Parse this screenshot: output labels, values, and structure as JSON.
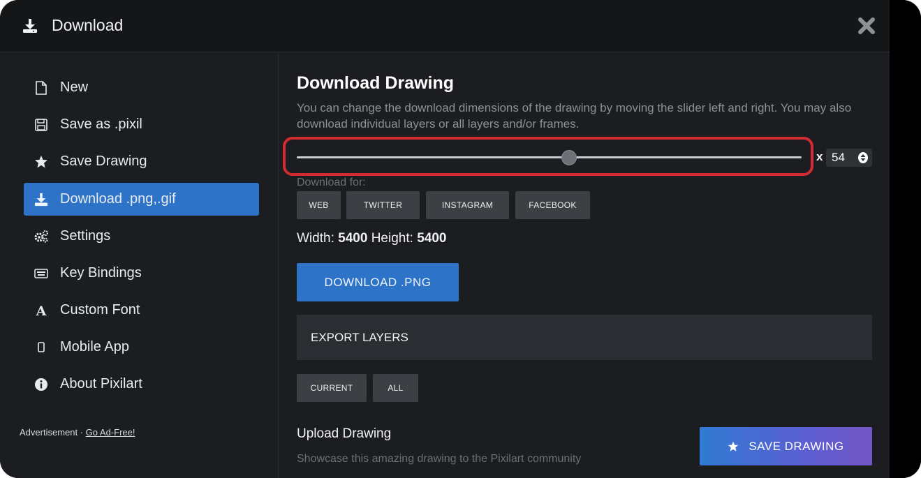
{
  "header": {
    "title": "Download",
    "icon": "download-icon",
    "close_icon": "close-icon"
  },
  "sidebar": {
    "items": [
      {
        "label": "New",
        "icon": "file-icon"
      },
      {
        "label": "Save as .pixil",
        "icon": "floppy-icon"
      },
      {
        "label": "Save Drawing",
        "icon": "star-icon"
      },
      {
        "label": "Download .png,.gif",
        "icon": "download-icon",
        "active": true
      },
      {
        "label": "Settings",
        "icon": "gears-icon"
      },
      {
        "label": "Key Bindings",
        "icon": "keyboard-icon"
      },
      {
        "label": "Custom Font",
        "icon": "font-icon"
      },
      {
        "label": "Mobile App",
        "icon": "mobile-icon"
      },
      {
        "label": "About Pixilart",
        "icon": "info-icon"
      }
    ],
    "ad": {
      "prefix": "Advertisement · ",
      "link": "Go Ad-Free!"
    }
  },
  "main": {
    "title": "Download Drawing",
    "description": "You can change the download dimensions of the drawing by moving the slider left and right. You may also download individual layers or all layers and/or frames.",
    "scale": {
      "prefix": "x",
      "value": "54",
      "slider_fraction": 0.54
    },
    "download_for_label": "Download for:",
    "presets": [
      "WEB",
      "TWITTER",
      "INSTAGRAM",
      "FACEBOOK"
    ],
    "dimensions": {
      "width_label": "Width:",
      "width": "5400",
      "height_label": "Height:",
      "height": "5400"
    },
    "download_button": "DOWNLOAD .PNG",
    "export_layers": "EXPORT LAYERS",
    "layer_options": [
      "CURRENT",
      "ALL"
    ],
    "upload": {
      "title": "Upload Drawing",
      "subtitle": "Showcase this amazing drawing to the Pixilart community",
      "button": "SAVE DRAWING"
    }
  },
  "colors": {
    "accent": "#2d74c9",
    "highlight": "#d32b32",
    "background": "#1b1d20",
    "gradient_end": "#7456c6"
  }
}
